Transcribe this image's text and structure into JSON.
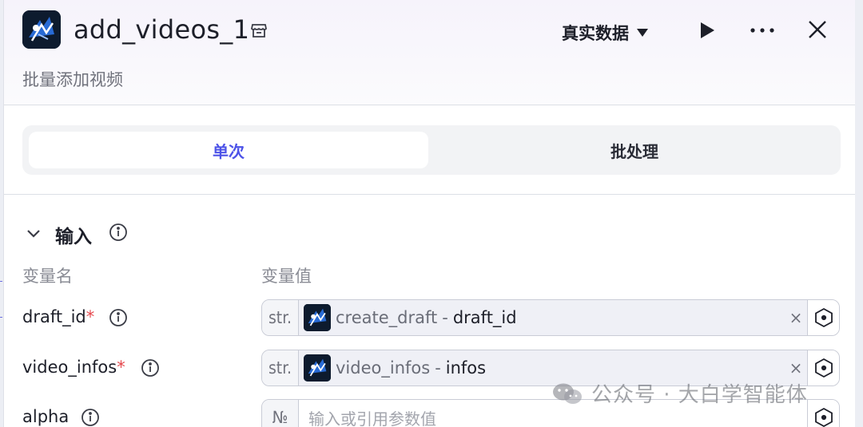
{
  "header": {
    "title": "add_videos_1",
    "subtitle": "批量添加视频",
    "data_mode": "真实数据"
  },
  "mode_tabs": [
    {
      "label": "单次",
      "active": true
    },
    {
      "label": "批处理",
      "active": false
    }
  ],
  "input_section": {
    "title": "输入",
    "col_name": "变量名",
    "col_value": "变量值",
    "params": [
      {
        "name": "draft_id",
        "required_mark": "*",
        "type": "str.",
        "ref_node": "create_draft",
        "sep": "-",
        "ref_var": "draft_id",
        "clear": "×"
      },
      {
        "name": "video_infos",
        "required_mark": "*",
        "type": "str.",
        "ref_node": "video_infos",
        "sep": "-",
        "ref_var": "infos",
        "clear": "×"
      },
      {
        "name": "alpha",
        "type": "№",
        "placeholder": "输入或引用参数值"
      }
    ]
  },
  "watermark": "公众号 · 大白学智能体",
  "colors": {
    "accent": "#4d53e8",
    "required": "#e5484d"
  }
}
